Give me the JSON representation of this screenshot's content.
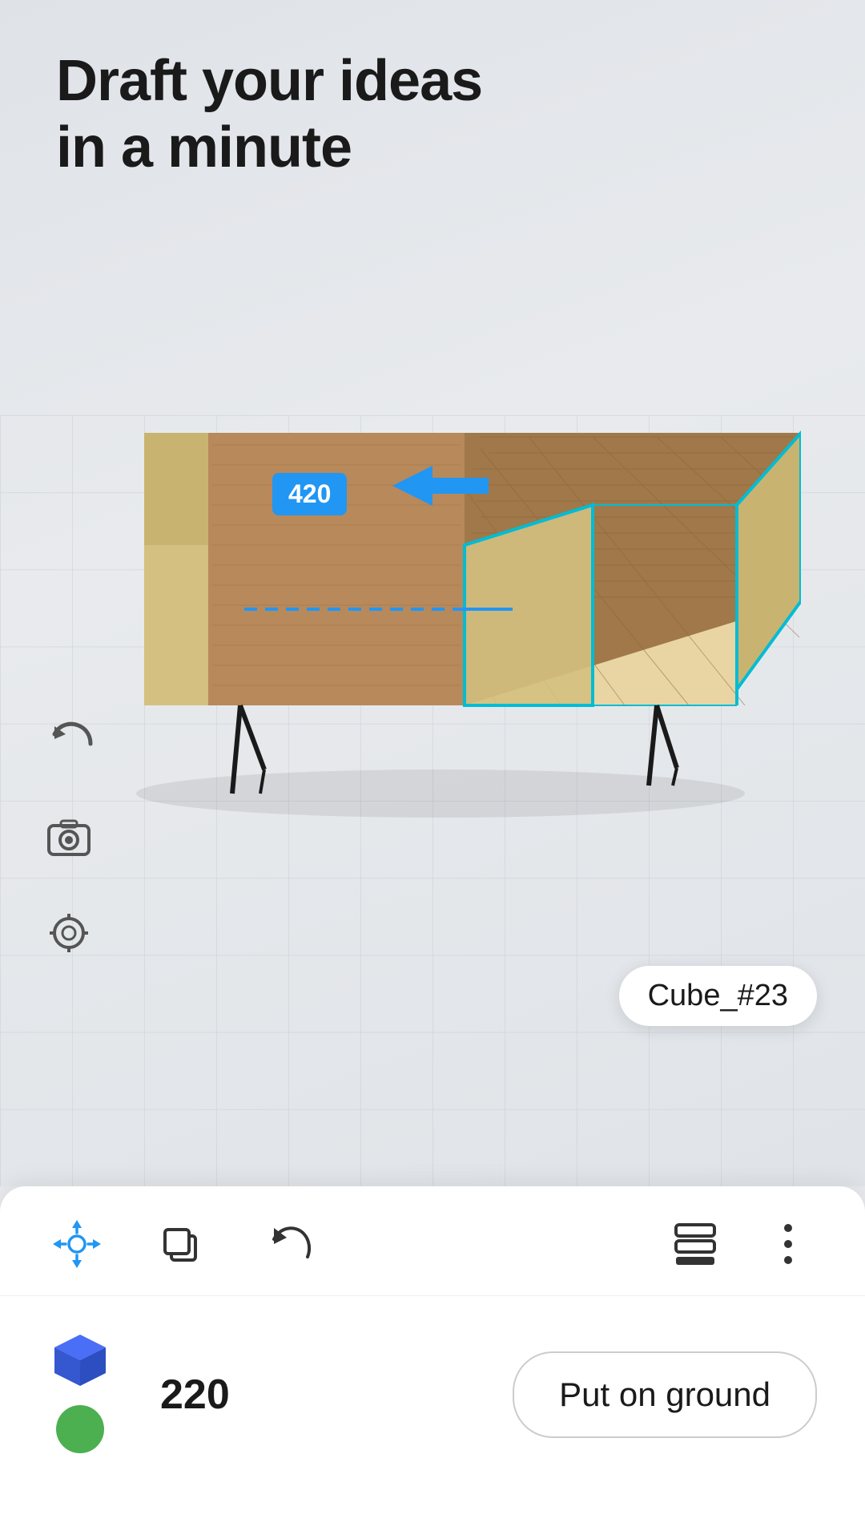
{
  "title": {
    "line1": "Draft your ideas",
    "line2": "in a minute"
  },
  "viewport": {
    "object_label": "Cube_#23",
    "measurement_value": "420",
    "grid_color": "#c8cdd4",
    "background_color": "#e8eaed"
  },
  "toolbar": {
    "move_tool_label": "move",
    "duplicate_tool_label": "duplicate",
    "undo_tool_label": "undo",
    "paint_tool_label": "paint",
    "more_tool_label": "more"
  },
  "action_bar": {
    "height_value": "220",
    "put_on_ground_label": "Put on ground",
    "cube_icon": "cube"
  },
  "left_toolbar": {
    "undo_icon": "undo",
    "camera_icon": "camera",
    "target_icon": "target"
  },
  "colors": {
    "blue_accent": "#2196F3",
    "cyan_selection": "#00BCD4",
    "toolbar_icon": "#555555",
    "background": "#e8eaed"
  }
}
